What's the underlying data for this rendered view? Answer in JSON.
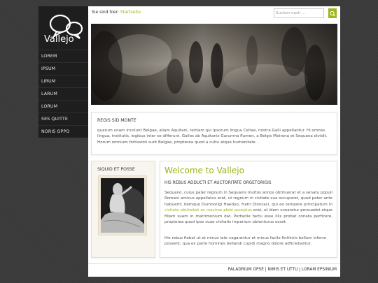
{
  "logo": {
    "name": "Vallejo"
  },
  "nav": {
    "items": [
      "LOREM",
      "IPSUM",
      "LIRUM",
      "LARUM",
      "LORUM",
      "SES QUITTE",
      "NORIS OPPO"
    ]
  },
  "breadcrumb": {
    "prefix": "Sie sind hier:",
    "current": "Startseite"
  },
  "search": {
    "placeholder": "Suchen nach ..."
  },
  "section1": {
    "title": "REGIS SID MONTE",
    "text": "quarum unam incolunt Belgae, aliam Aquitani, tertiam qui ipsorum lingua Celtae, nostra Galli appellantur. Hi omnes lingua, institutis, legibus inter se differunt. Gallos ab Aquitanis Garumna flumen, a Belgis Matrona et Sequana dividit. Horum omnium fortissimi sunt Belgae, propterea quod a cultu atque humanitate ."
  },
  "sidebar_box": {
    "title": "SIQUID ET POSSE"
  },
  "welcome": {
    "title": "Welcome to Vallejo",
    "subtitle": "HIS REBUS ADDUCTI ET AUCTORITATE ORGETORIGIS",
    "p1_before": "Sequano, cuius pater regnum in Sequanis multos annos obtinuerat et a senatu populi Romani amicus appellatus erat, ut regnum in civitate sua occuparet, quod pater ante habuerit; itemque Dumnorigi Haeduo, fratri Diviciaci, qui eo tempore principatum in ",
    "p1_highlight": "civitate obtinebat ac maxime plebi acceptus",
    "p1_after": " erat, ut idem conaretur persuadet eique filiam suam in matrimonium dat. Perfacile factu esse illis probat conata perficere, propterea quod ipse suae civitatis imperium obtenturus esset.",
    "p2": "His rebus fiebat ut et minus late vagarentur et minus facile finitimis bellum inferre possent; qua ex parte homines bellandi cupidi magno dolore adficiebantur."
  },
  "footer": {
    "links": [
      "PALADRIUM OPSE",
      "NIMIS ET UTTU",
      "LORAM EPSINIUM"
    ]
  },
  "colors": {
    "accent": "#9ab617",
    "background": "#3a3a3a",
    "sidebar": "#1e1e1e"
  }
}
